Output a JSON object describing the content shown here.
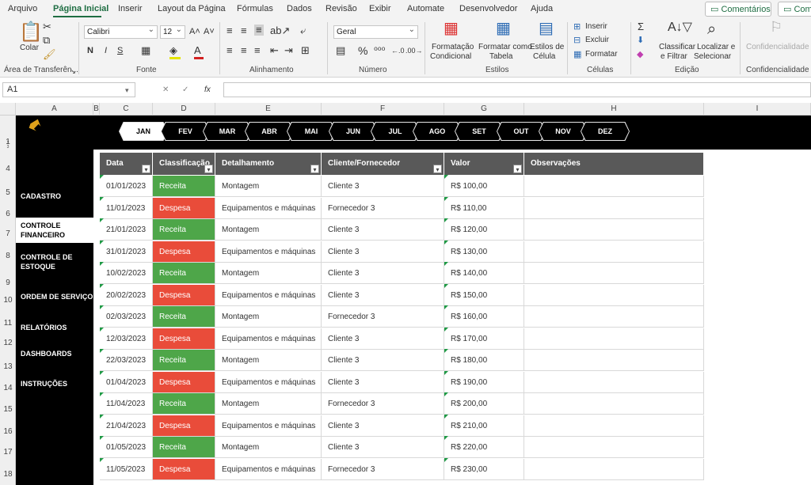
{
  "ribbon_tabs": [
    "Arquivo",
    "Página Inicial",
    "Inserir",
    "Layout da Página",
    "Fórmulas",
    "Dados",
    "Revisão",
    "Exibir",
    "Automate",
    "Desenvolvedor",
    "Ajuda"
  ],
  "active_tab": "Página Inicial",
  "top_buttons": {
    "comments": "Comentários",
    "share": "Comp"
  },
  "clipboard": {
    "paste": "Colar",
    "label": "Área de Transferên..."
  },
  "font": {
    "name": "Calibri",
    "size": "12",
    "bold": "N",
    "italic": "I",
    "underline": "S",
    "label": "Fonte"
  },
  "alignment": {
    "label": "Alinhamento"
  },
  "number": {
    "format": "Geral",
    "label": "Número"
  },
  "styles": {
    "conditional": [
      "Formatação",
      "Condicional"
    ],
    "as_table": [
      "Formatar como",
      "Tabela"
    ],
    "cell_styles": [
      "Estilos de",
      "Célula"
    ],
    "label": "Estilos"
  },
  "cells": {
    "insert": "Inserir",
    "delete": "Excluir",
    "format": "Formatar",
    "label": "Células"
  },
  "editing": {
    "sort": [
      "Classificar",
      "e Filtrar"
    ],
    "find": [
      "Localizar e",
      "Selecionar"
    ],
    "label": "Edição"
  },
  "confidentiality": {
    "button": "Confidencialidade",
    "label": "Confidencialidade"
  },
  "name_box": "A1",
  "formula_fx": "fx",
  "columns": [
    "A",
    "B",
    "C",
    "D",
    "E",
    "F",
    "G",
    "H",
    "I"
  ],
  "rows": [
    "1",
    "2",
    "3",
    "4",
    "5",
    "6",
    "7",
    "8",
    "9",
    "10",
    "11",
    "12",
    "13",
    "14",
    "15",
    "16",
    "17",
    "18"
  ],
  "months": [
    "JAN",
    "FEV",
    "MAR",
    "ABR",
    "MAI",
    "JUN",
    "JUL",
    "AGO",
    "SET",
    "OUT",
    "NOV",
    "DEZ"
  ],
  "active_month": "JAN",
  "sidebar": [
    {
      "label": "CADASTRO"
    },
    {
      "label": "CONTROLE FINANCEIRO",
      "lines": [
        "CONTROLE",
        "FINANCEIRO"
      ],
      "active": true
    },
    {
      "label": "CONTROLE DE ESTOQUE",
      "lines": [
        "CONTROLE DE",
        "ESTOQUE"
      ]
    },
    {
      "label": "ORDEM DE SERVIÇO"
    },
    {
      "label": "RELATÓRIOS"
    },
    {
      "label": "DASHBOARDS"
    },
    {
      "label": "INSTRUÇÕES"
    }
  ],
  "table": {
    "headers": [
      "Data",
      "Classificação",
      "Detalhamento",
      "Cliente/Fornecedor",
      "Valor",
      "Observações"
    ],
    "rows": [
      [
        "01/01/2023",
        "Receita",
        "Montagem",
        "Cliente 3",
        "R$ 100,00",
        ""
      ],
      [
        "11/01/2023",
        "Despesa",
        "Equipamentos e máquinas",
        "Fornecedor 3",
        "R$ 110,00",
        ""
      ],
      [
        "21/01/2023",
        "Receita",
        "Montagem",
        "Cliente 3",
        "R$ 120,00",
        ""
      ],
      [
        "31/01/2023",
        "Despesa",
        "Equipamentos e máquinas",
        "Cliente 3",
        "R$ 130,00",
        ""
      ],
      [
        "10/02/2023",
        "Receita",
        "Montagem",
        "Cliente 3",
        "R$ 140,00",
        ""
      ],
      [
        "20/02/2023",
        "Despesa",
        "Equipamentos e máquinas",
        "Cliente 3",
        "R$ 150,00",
        ""
      ],
      [
        "02/03/2023",
        "Receita",
        "Montagem",
        "Fornecedor 3",
        "R$ 160,00",
        ""
      ],
      [
        "12/03/2023",
        "Despesa",
        "Equipamentos e máquinas",
        "Cliente 3",
        "R$ 170,00",
        ""
      ],
      [
        "22/03/2023",
        "Receita",
        "Montagem",
        "Cliente 3",
        "R$ 180,00",
        ""
      ],
      [
        "01/04/2023",
        "Despesa",
        "Equipamentos e máquinas",
        "Cliente 3",
        "R$ 190,00",
        ""
      ],
      [
        "11/04/2023",
        "Receita",
        "Montagem",
        "Fornecedor 3",
        "R$ 200,00",
        ""
      ],
      [
        "21/04/2023",
        "Despesa",
        "Equipamentos e máquinas",
        "Cliente 3",
        "R$ 210,00",
        ""
      ],
      [
        "01/05/2023",
        "Receita",
        "Montagem",
        "Cliente 3",
        "R$ 220,00",
        ""
      ],
      [
        "11/05/2023",
        "Despesa",
        "Equipamentos e máquinas",
        "Fornecedor 3",
        "R$ 230,00",
        ""
      ]
    ]
  },
  "colors": {
    "receita": "#4ea649",
    "despesa": "#e94c3a",
    "header": "#595959",
    "accent": "#1f6e43"
  }
}
